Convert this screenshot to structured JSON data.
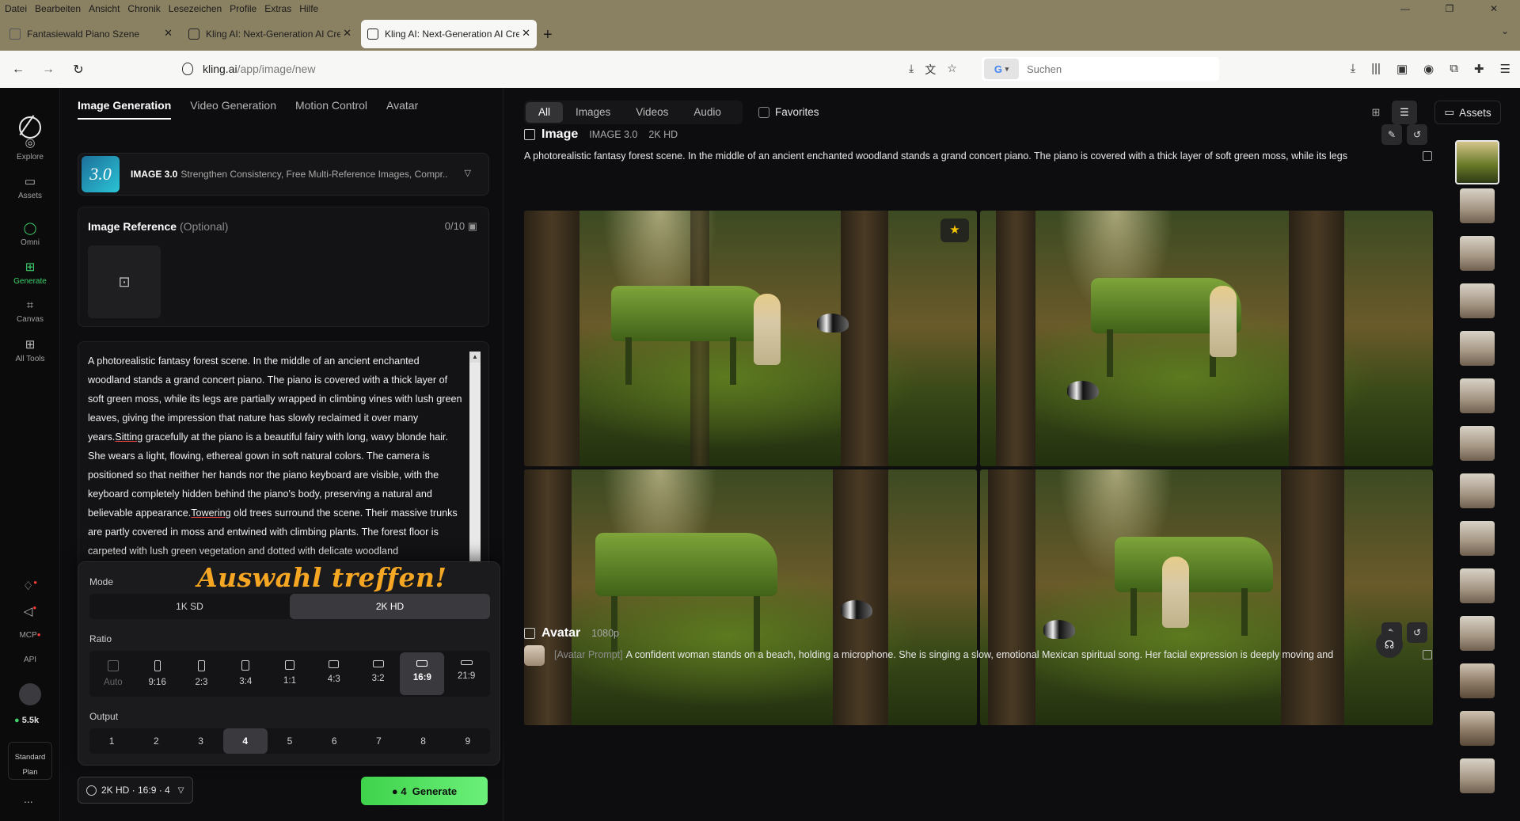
{
  "browser": {
    "menu": [
      "Datei",
      "Bearbeiten",
      "Ansicht",
      "Chronik",
      "Lesezeichen",
      "Profile",
      "Extras",
      "Hilfe"
    ],
    "tabs": [
      {
        "title": "Fantasiewald Piano Szene",
        "active": false
      },
      {
        "title": "Kling AI: Next-Generation AI Cre",
        "active": false
      },
      {
        "title": "Kling AI: Next-Generation AI Cre",
        "active": true
      }
    ],
    "url_domain": "kling.ai",
    "url_path": "/app/image/new",
    "search_placeholder": "Suchen",
    "search_engine": "G"
  },
  "rail": {
    "items": [
      {
        "label": "Explore",
        "icon": "compass-icon"
      },
      {
        "label": "Assets",
        "icon": "folder-icon"
      },
      {
        "label": "Omni",
        "icon": "omni-icon"
      },
      {
        "label": "Generate",
        "icon": "generate-icon",
        "active": true
      },
      {
        "label": "Canvas",
        "icon": "canvas-icon"
      },
      {
        "label": "All Tools",
        "icon": "grid-icon"
      }
    ],
    "bottom": {
      "mcp": "MCP",
      "api": "API",
      "credits": "5.5k",
      "plan_line1": "Standard",
      "plan_line2": "Plan",
      "more": "..."
    }
  },
  "left": {
    "tabs": [
      "Image Generation",
      "Video Generation",
      "Motion Control",
      "Avatar"
    ],
    "active_tab": 0,
    "model": {
      "badge": "3.0",
      "name": "IMAGE 3.0",
      "desc": "Strengthen Consistency, Free Multi-Reference Images, Compr..."
    },
    "reference": {
      "title": "Image Reference",
      "optional": "(Optional)",
      "count": "0/10"
    },
    "prompt_parts": [
      "A photorealistic fantasy forest scene. In the middle of an ancient enchanted woodland stands a grand concert piano. The piano is covered with a thick layer of soft green moss, while its legs are partially wrapped in climbing vines with lush green leaves, giving the impression that nature has slowly reclaimed it over many years.",
      "Sitting",
      " gracefully at the piano is a beautiful fairy with long, wavy blonde hair. She wears a light, flowing, ethereal gown in soft natural colors. The camera is positioned so that neither her hands nor the piano keyboard are visible, with the keyboard completely hidden behind the piano's body, preserving a natural and believable appearance.",
      "Towering",
      " old trees surround the scene. Their massive trunks are partly covered in moss and entwined with climbing plants. The forest floor is carpeted with lush green vegetation and dotted with delicate woodland"
    ],
    "settings": {
      "mode_label": "Mode",
      "callout": "Auswahl treffen!",
      "modes": [
        "1K SD",
        "2K HD"
      ],
      "mode_selected": 1,
      "ratio_label": "Ratio",
      "ratios": [
        "Auto",
        "9:16",
        "2:3",
        "3:4",
        "1:1",
        "4:3",
        "3:2",
        "16:9",
        "21:9"
      ],
      "ratio_selected": 7,
      "output_label": "Output",
      "outputs": [
        "1",
        "2",
        "3",
        "4",
        "5",
        "6",
        "7",
        "8",
        "9"
      ],
      "output_selected": 3
    },
    "summary": "2K HD · 16:9 · 4",
    "generate": {
      "cost": "4",
      "label": "Generate"
    }
  },
  "main": {
    "filters": [
      "All",
      "Images",
      "Videos",
      "Audio"
    ],
    "filter_selected": 0,
    "favorites": "Favorites",
    "assets": "Assets",
    "image_section": {
      "title": "Image",
      "model": "IMAGE 3.0",
      "quality": "2K HD",
      "desc": "A photorealistic fantasy forest scene. In the middle of an ancient enchanted woodland stands a grand concert piano. The piano is covered with a thick layer of soft green moss, while its legs"
    },
    "avatar_section": {
      "title": "Avatar",
      "quality": "1080p",
      "tag": "[Avatar Prompt]",
      "desc": "A confident woman stands on a beach, holding a microphone. She is singing a slow, emotional Mexican spiritual song. Her facial expression is deeply moving and"
    }
  },
  "colors": {
    "accent_green": "#3fd24b",
    "callout": "#f5a623",
    "browser_frame": "#8a8062"
  }
}
